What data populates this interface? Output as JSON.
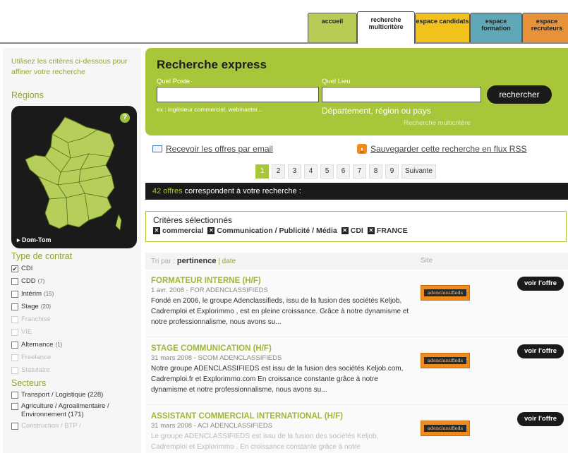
{
  "tabs": [
    {
      "label": "accueil"
    },
    {
      "label": "recherche multicritère"
    },
    {
      "label": "espace candidats"
    },
    {
      "label": "espace formation"
    },
    {
      "label": "espace recruteurs"
    }
  ],
  "sidebar": {
    "intro": "Utilisez les critères ci-dessous pour affiner votre recherche",
    "regions_title": "Régions",
    "map_help": "?",
    "domtom": "▸ Dom-Tom",
    "contrat_title": "Type de contrat",
    "contrats": [
      {
        "label": "CDI",
        "count": "",
        "checked": true,
        "enabled": true
      },
      {
        "label": "CDD",
        "count": "(7)",
        "checked": false,
        "enabled": true
      },
      {
        "label": "Intérim",
        "count": "(15)",
        "checked": false,
        "enabled": true
      },
      {
        "label": "Stage",
        "count": "(20)",
        "checked": false,
        "enabled": true
      },
      {
        "label": "Franchise",
        "count": "",
        "checked": false,
        "enabled": false
      },
      {
        "label": "VIE",
        "count": "",
        "checked": false,
        "enabled": false
      },
      {
        "label": "Alternance",
        "count": "(1)",
        "checked": false,
        "enabled": true
      },
      {
        "label": "Freelance",
        "count": "",
        "checked": false,
        "enabled": false
      },
      {
        "label": "Statutaire",
        "count": "",
        "checked": false,
        "enabled": false
      }
    ],
    "secteurs_title": "Secteurs",
    "secteurs": [
      {
        "label": "Transport / Logistique (228)",
        "enabled": true
      },
      {
        "label": "Agriculture / Agroalimentaire / Environnement (171)",
        "enabled": true
      },
      {
        "label": "Construction / BTP /",
        "enabled": false
      }
    ]
  },
  "express": {
    "title": "Recherche express",
    "poste_label": "Quel Poste",
    "poste_value": "",
    "poste_hint": "ex : ingénieur commercial, webmaster...",
    "lieu_label": "Quel Lieu",
    "lieu_value": "",
    "lieu_hint": "Département, région ou pays",
    "search_button": "rechercher",
    "multicritere_link": "Recherche multicritère"
  },
  "links": {
    "email": "Recevoir les offres par email",
    "rss": "Sauvegarder cette recherche en flux RSS"
  },
  "pager": {
    "pages": [
      "1",
      "2",
      "3",
      "4",
      "5",
      "6",
      "7",
      "8",
      "9"
    ],
    "current": "1",
    "next": "Suivante"
  },
  "results": {
    "count": "42 offres",
    "count_suffix": " correspondent à votre recherche :"
  },
  "criteria": {
    "title": "Critères sélectionnés",
    "items": [
      "commercial",
      "Communication / Publicité / Média",
      "CDI",
      "FRANCE"
    ]
  },
  "sort": {
    "prefix": "Tri par :",
    "pertinence": "pertinence",
    "separator": "|",
    "date": "date",
    "site": "Site"
  },
  "offers": [
    {
      "title": "FORMATEUR INTERNE (H/F)",
      "meta": "1 avr. 2008 - FOR ADENCLASSIFIEDS",
      "desc": "Fondé en 2006, le groupe Adenclassifieds, issu de la fusion des sociétés Keljob, Cadremploi et Explorimmo , est en pleine croissance. Grâce à notre dynamisme et notre professionnalisme, nous avons su...",
      "logo": "adenclassifieds",
      "button": "voir l'offre"
    },
    {
      "title": "STAGE COMMUNICATION (H/F)",
      "meta": "31 mars 2008 - SCOM ADENCLASSIFIEDS",
      "desc": "Notre groupe ADENCLASSIFIEDS est issu de la fusion des sociétés Keljob.com, Cadremploi.fr et Explorimmo.com En croissance constante grâce à notre dynamisme et notre professionnalisme, nous avons su...",
      "logo": "adenclassifieds",
      "button": "voir l'offre"
    },
    {
      "title": "ASSISTANT COMMERCIAL INTERNATIONAL (H/F)",
      "meta": "31 mars 2008 - ACI ADENCLASSIFIEDS",
      "desc": "Le groupe ADENCLASSIFIEDS est issu de la fusion des sociétés Keljob, Cadremploi et Explorimmo . En croissance constante grâce à notre",
      "logo": "adenclassifieds",
      "button": "voir l'offre"
    }
  ],
  "colors": {
    "accent": "#a7c63a",
    "dark": "#1a1a1a",
    "logo_orange": "#f08a1c"
  }
}
